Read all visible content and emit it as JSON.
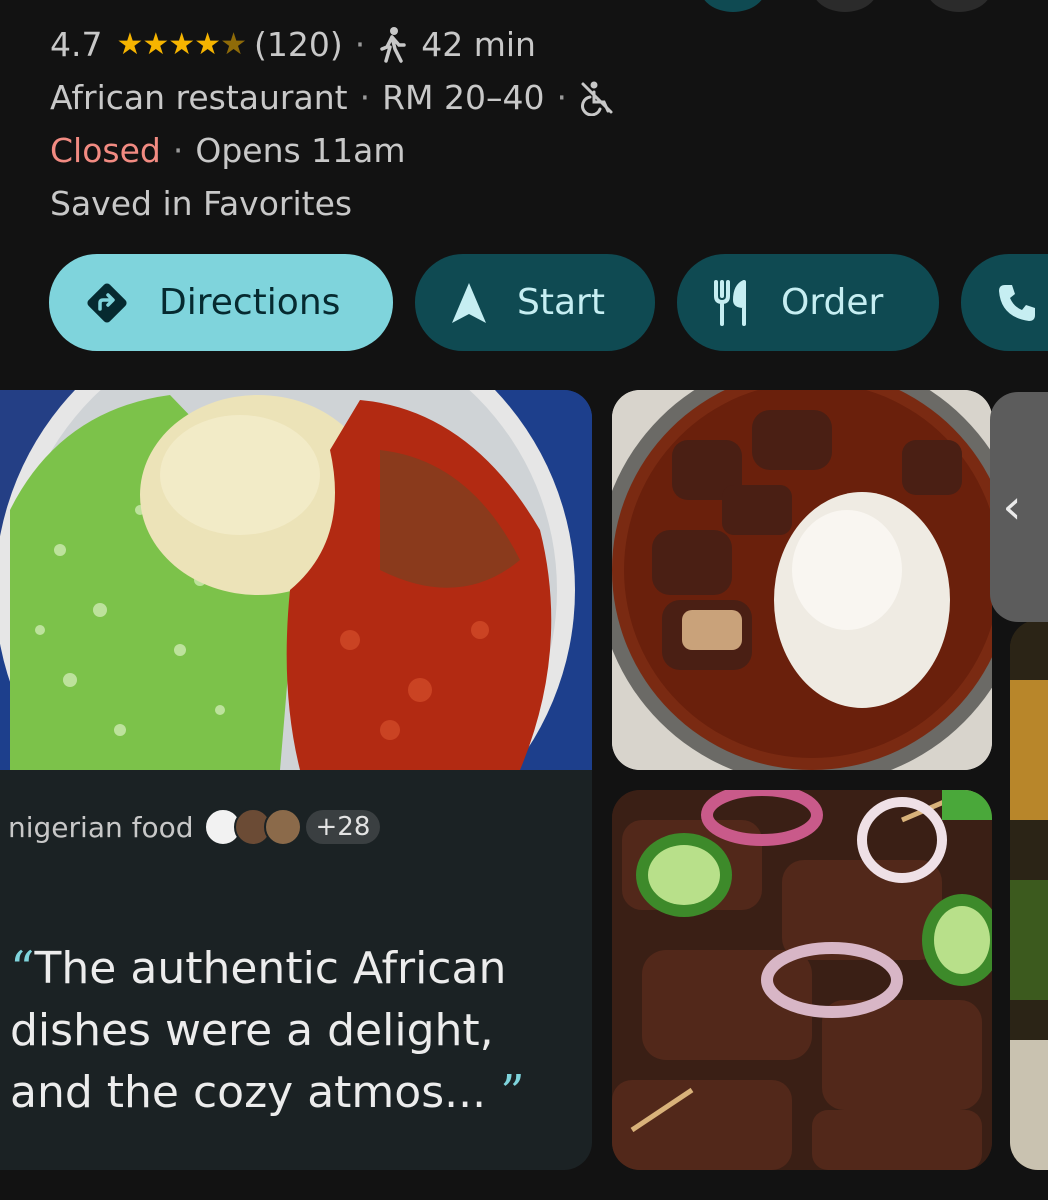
{
  "place": {
    "rating": "4.7",
    "review_count": "(120)",
    "walk_time": "42 min",
    "category": "African restaurant",
    "price": "RM 20–40",
    "status": "Closed",
    "hours": "Opens 11am",
    "saved": "Saved in Favorites"
  },
  "actions": {
    "directions": "Directions",
    "start": "Start",
    "order": "Order"
  },
  "review_card": {
    "tag": "nigerian food",
    "more_count": "+28",
    "quote_open": "“",
    "quote": "The authentic African dishes were a delight, and the cozy atmos...",
    "quote_close": "”"
  },
  "colors": {
    "background": "#121212",
    "accent": "#7fd4dc",
    "button_dark": "#0f4a52",
    "closed": "#f28b82",
    "star": "#f6b400"
  }
}
